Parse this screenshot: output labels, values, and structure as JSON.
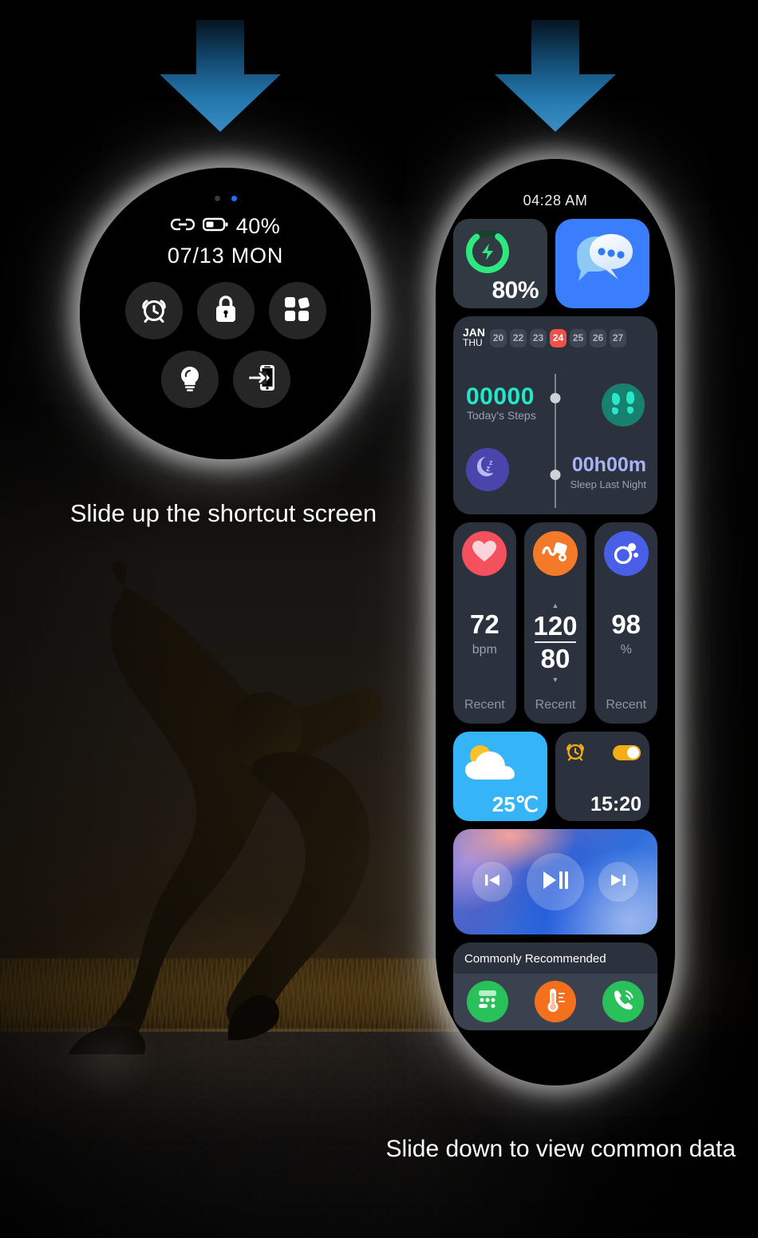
{
  "captions": {
    "slide_up": "Slide up the shortcut screen",
    "slide_down": "Slide down to view common data"
  },
  "round_watch": {
    "battery_percent": "40%",
    "date": "07/13 MON",
    "page_dots": 2,
    "active_dot": 1,
    "status_icons": [
      "link-icon",
      "battery-icon"
    ],
    "shortcuts_row1": [
      {
        "name": "alarm-clock-icon",
        "label": "Alarm"
      },
      {
        "name": "lock-icon",
        "label": "Lock"
      },
      {
        "name": "apps-grid-icon",
        "label": "Apps"
      }
    ],
    "shortcuts_row2": [
      {
        "name": "brightness-bulb-icon",
        "label": "Brightness"
      },
      {
        "name": "find-phone-icon",
        "label": "Find Phone"
      }
    ]
  },
  "capsule_watch": {
    "time": "04:28 AM",
    "battery": {
      "percent": "80%",
      "ring_value": 80,
      "icon": "charging-bolt-icon",
      "color": "#2ee87f"
    },
    "messages": {
      "icon": "chat-bubbles-icon",
      "bg": "#3b7efd"
    },
    "activity": {
      "month": "JAN",
      "weekday": "THU",
      "days": [
        "20",
        "22",
        "23",
        "24",
        "25",
        "26",
        "27"
      ],
      "selected_day": "24",
      "selected_color": "#f24f46",
      "steps_value": "00000",
      "steps_label": "Today's Steps",
      "steps_color": "#21e8c8",
      "steps_icon": "footprints-icon",
      "sleep_value": "00h00m",
      "sleep_label": "Sleep Last Night",
      "sleep_color": "#a9b4f7",
      "sleep_icon": "sleep-moon-icon"
    },
    "health": [
      {
        "icon": "heart-icon",
        "icon_bg": "#f4505e",
        "value": "72",
        "unit": "bpm",
        "status": "Recent"
      },
      {
        "icon": "blood-pressure-icon",
        "icon_bg": "#f47a2a",
        "systolic": "120",
        "diastolic": "80",
        "status": "Recent"
      },
      {
        "icon": "blood-oxygen-icon",
        "icon_bg": "#4a5fe8",
        "value": "98",
        "unit": "%",
        "status": "Recent"
      }
    ],
    "weather": {
      "icon": "sun-cloud-icon",
      "temperature": "25℃",
      "bg": "#35b4f7"
    },
    "alarm": {
      "icon": "alarm-clock-icon",
      "toggle_on": true,
      "toggle_color": "#f4ad17",
      "time": "15:20"
    },
    "music": {
      "prev_icon": "skip-previous-icon",
      "playpause_icon": "play-pause-icon",
      "next_icon": "skip-next-icon"
    },
    "recommended": {
      "title": "Commonly Recommended",
      "apps": [
        {
          "icon": "calculator-icon",
          "bg": "#29c159"
        },
        {
          "icon": "thermometer-icon",
          "bg": "#f4701c"
        },
        {
          "icon": "phone-call-icon",
          "bg": "#29c159"
        }
      ]
    }
  },
  "arrows": {
    "left_label": "down-arrow-icon",
    "right_label": "down-arrow-icon",
    "color_top": "#0a1c2c",
    "color_bottom": "#2a7fb8"
  }
}
